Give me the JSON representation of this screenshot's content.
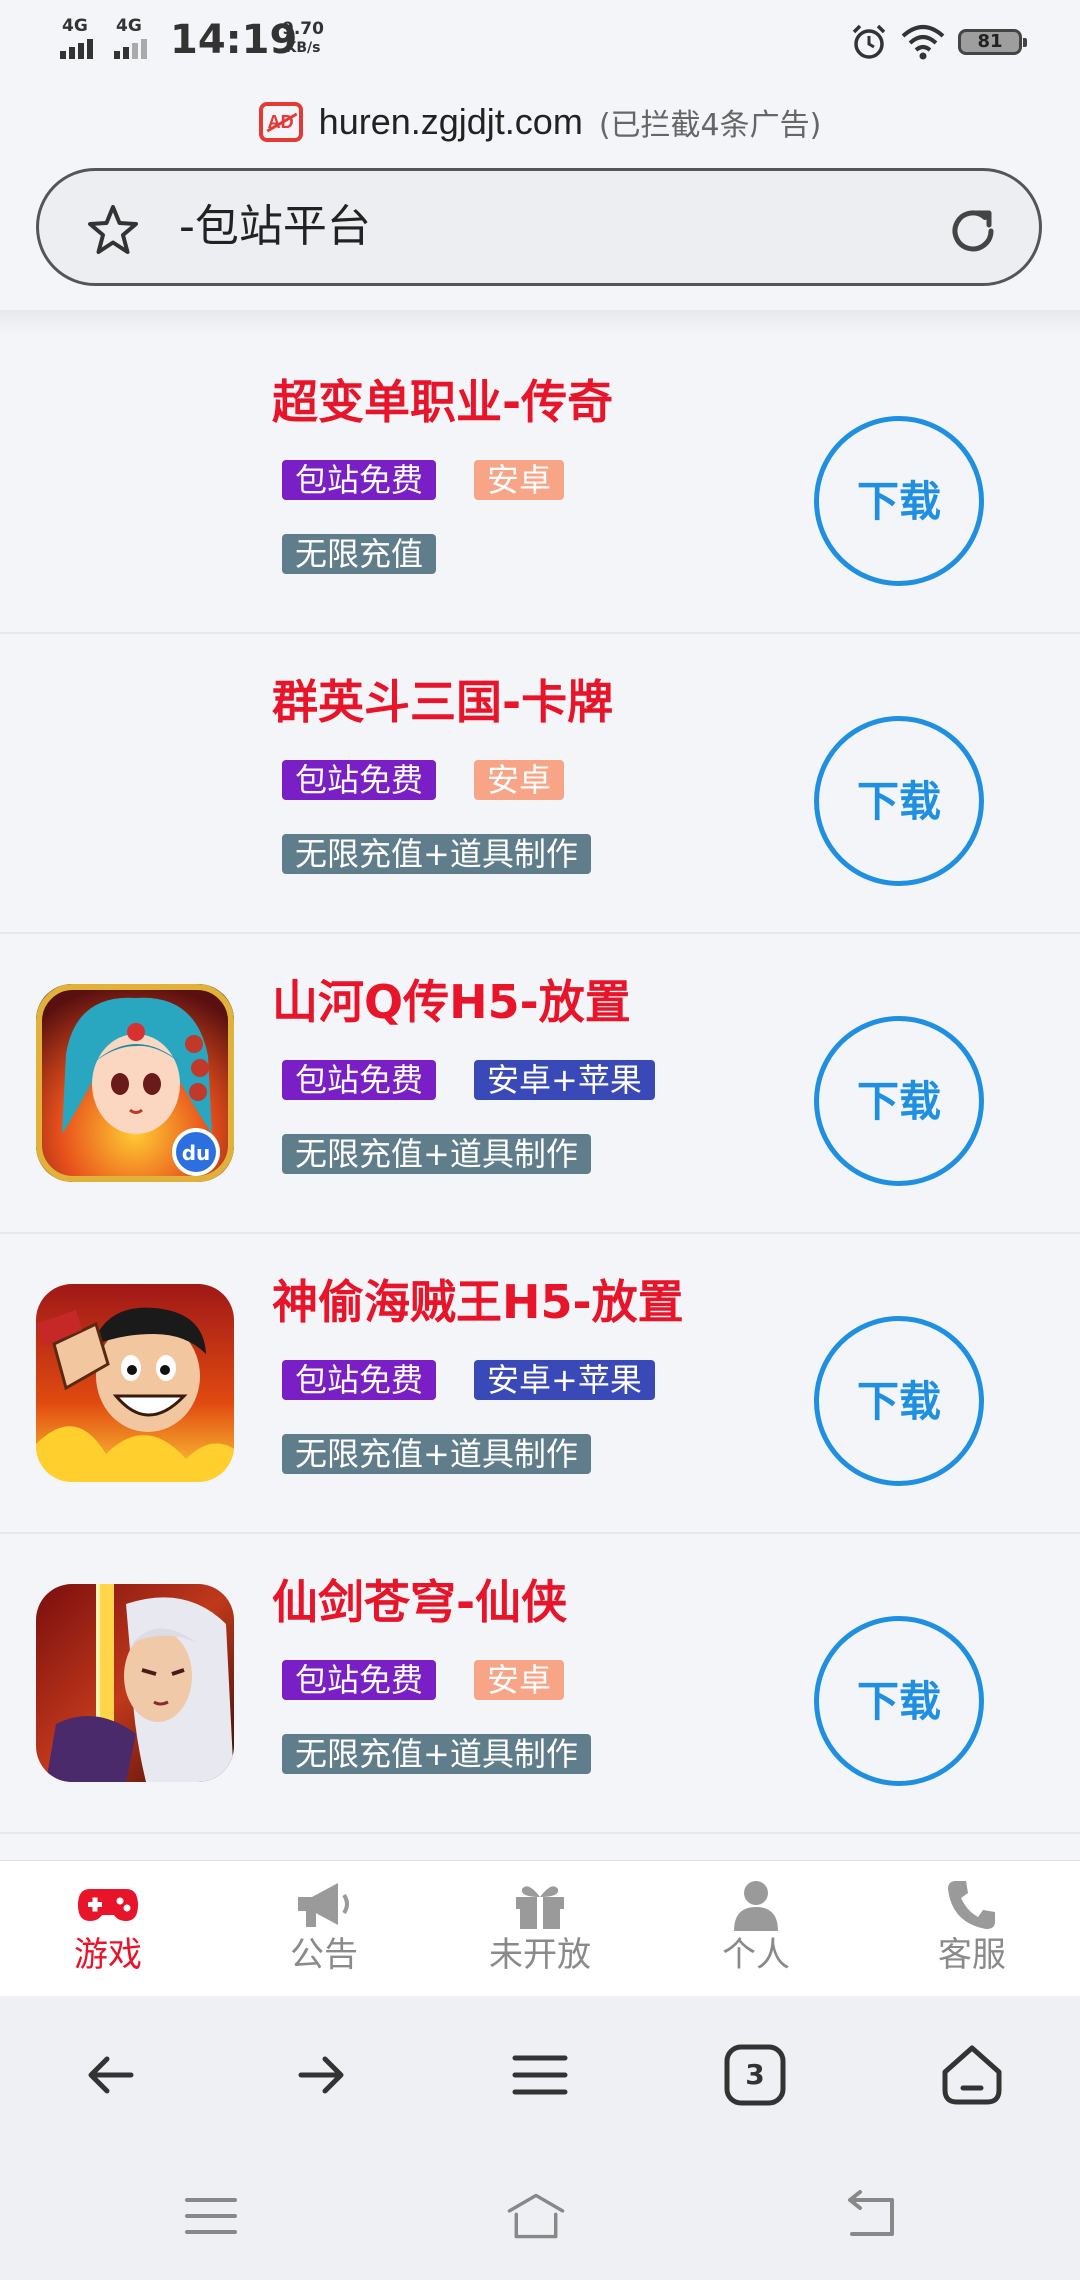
{
  "status_bar": {
    "net1": "4G",
    "net2": "4G",
    "time": "14:19",
    "speed_value": "9.70",
    "speed_unit": "KB/s",
    "battery": "81",
    "icons": [
      "alarm-icon",
      "wifi-icon",
      "battery-icon"
    ]
  },
  "url_bar": {
    "ad_badge": "AD",
    "domain": "huren.zgjdjt.com",
    "blocked_text": "(已拦截4条广告)"
  },
  "search_bar": {
    "title": "-包站平台"
  },
  "games": [
    {
      "name": "超变单职业-传奇",
      "has_icon": false,
      "tags": [
        "包站免费",
        "安卓"
      ],
      "feature": "无限充值",
      "download": "下载"
    },
    {
      "name": "群英斗三国-卡牌",
      "has_icon": false,
      "tags": [
        "包站免费",
        "安卓"
      ],
      "feature": "无限充值+道具制作",
      "download": "下载"
    },
    {
      "name": "山河Q传H5-放置",
      "has_icon": true,
      "icon": "fantasy-girl-game-icon",
      "tags": [
        "包站免费",
        "安卓+苹果"
      ],
      "feature": "无限充值+道具制作",
      "download": "下载"
    },
    {
      "name": "神偷海贼王H5-放置",
      "has_icon": true,
      "icon": "pirate-game-icon",
      "tags": [
        "包站免费",
        "安卓+苹果"
      ],
      "feature": "无限充值+道具制作",
      "download": "下载"
    },
    {
      "name": "仙剑苍穹-仙侠",
      "has_icon": true,
      "icon": "swordsman-game-icon",
      "tags": [
        "包站免费",
        "安卓"
      ],
      "feature": "无限充值+道具制作",
      "download": "下载"
    }
  ],
  "tab_bar": {
    "items": [
      {
        "label": "游戏",
        "icon": "gamepad-icon",
        "active": true
      },
      {
        "label": "公告",
        "icon": "megaphone-icon",
        "active": false
      },
      {
        "label": "未开放",
        "icon": "gift-icon",
        "active": false
      },
      {
        "label": "个人",
        "icon": "person-icon",
        "active": false
      },
      {
        "label": "客服",
        "icon": "phone-icon",
        "active": false
      }
    ]
  },
  "browser_toolbar": {
    "tab_count": "3",
    "icons": [
      "back-arrow-icon",
      "forward-arrow-icon",
      "menu-icon",
      "tabs-icon",
      "home-icon"
    ]
  },
  "system_nav": {
    "icons": [
      "recent-apps-icon",
      "home-nav-icon",
      "back-nav-icon"
    ]
  },
  "colors": {
    "title_red": "#e8152a",
    "download_blue": "#1e8fe1",
    "tag_free": "#7a1fc6",
    "tag_android": "#f8a487",
    "tag_both": "#3a49b8",
    "tag_unlimited": "#607d8b"
  }
}
